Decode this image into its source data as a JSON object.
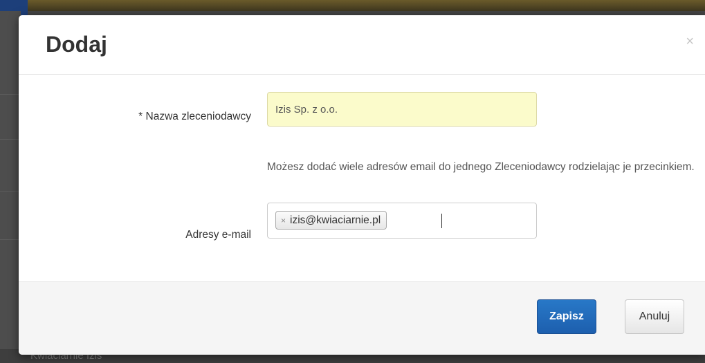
{
  "dialog": {
    "title": "Dodaj",
    "close_label": "×"
  },
  "form": {
    "client_name": {
      "label": "* Nazwa zleceniodawcy",
      "value": "Izis Sp. z o.o."
    },
    "emails": {
      "help_text": "Możesz dodać wiele adresów email do jednego Zleceniodawcy rodzielając je przecinkiem.",
      "label": "Adresy e-mail",
      "tags": [
        "izis@kwiaciarnie.pl"
      ],
      "tag_remove_icon": "×"
    }
  },
  "footer": {
    "save_label": "Zapisz",
    "cancel_label": "Anuluj"
  },
  "background": {
    "row_text": "Kwiaciarnie Izis"
  },
  "colors": {
    "primary_button": "#1d5fae",
    "name_field_background": "#fbfbcb"
  }
}
